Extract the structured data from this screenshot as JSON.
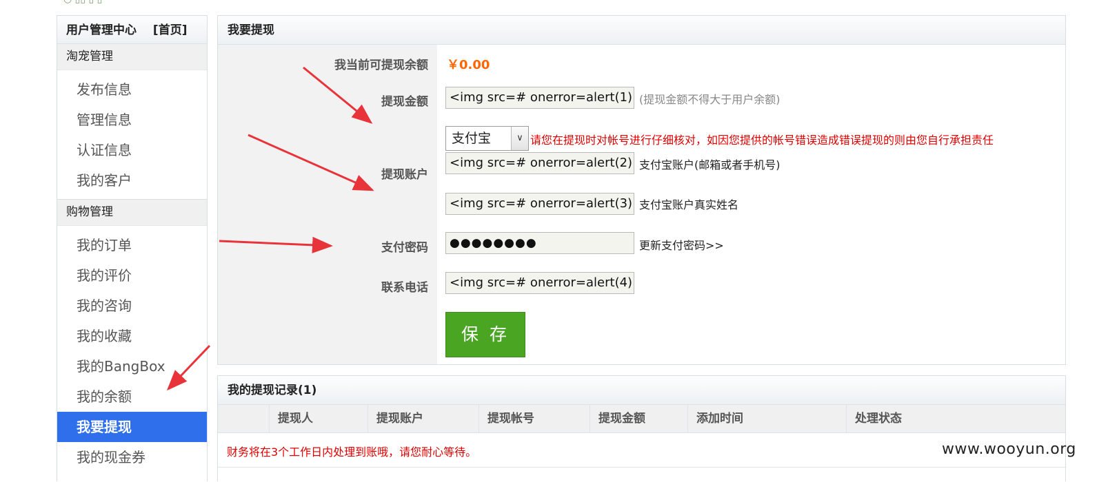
{
  "sidebar": {
    "title": "用户管理中心",
    "home_link": "[首页]",
    "groups": [
      {
        "label": "淘宠管理",
        "items": [
          "发布信息",
          "管理信息",
          "认证信息",
          "我的客户"
        ]
      },
      {
        "label": "购物管理",
        "items": [
          "我的订单",
          "我的评价",
          "我的咨询",
          "我的收藏",
          "我的BangBox",
          "我的余额",
          "我要提现",
          "我的现金券"
        ]
      }
    ],
    "active_item": "我要提现"
  },
  "withdraw": {
    "title": "我要提现",
    "balance_label": "我当前可提现余额",
    "balance_value": "￥0.00",
    "amount_label": "提现金额",
    "amount_value": "<img src=# onerror=alert(1)>",
    "amount_hint": "(提现金额不得大于用户余额)",
    "account_label": "提现账户",
    "account_type_selected": "支付宝",
    "account_warning": "请您在提现时对帐号进行仔细核对，如因您提供的帐号错误造成错误提现的则由您自行承担责任",
    "account_value": "<img src=# onerror=alert(2)>",
    "account_hint": "支付宝账户(邮箱或者手机号)",
    "name_value": "<img src=# onerror=alert(3)>",
    "name_hint": "支付宝账户真实姓名",
    "password_label": "支付密码",
    "password_value": "●●●●●●●●",
    "password_link": "更新支付密码>>",
    "phone_label": "联系电话",
    "phone_value": "<img src=# onerror=alert(4)>",
    "save_label": "保 存"
  },
  "records": {
    "title": "我的提现记录(1)",
    "columns": [
      "提现人",
      "提现账户",
      "提现帐号",
      "提现金额",
      "添加时间",
      "处理状态"
    ],
    "notice": "财务将在3个工作日内处理到账哦，请您耐心等待。"
  },
  "watermark": "www.wooyun.org",
  "colors": {
    "active": "#2f6fec",
    "balance": "#ff6600",
    "warning": "#dd0000",
    "save": "#4aa523",
    "arrow": "#e8333a"
  }
}
